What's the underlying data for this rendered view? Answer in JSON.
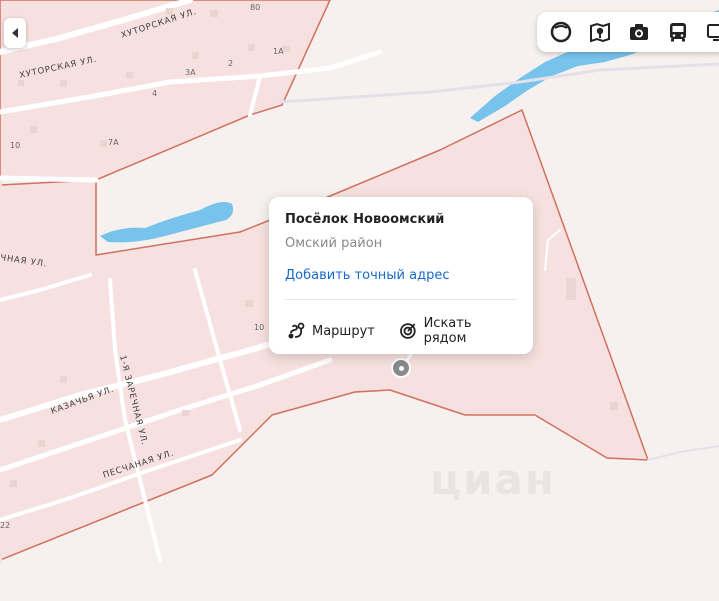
{
  "map": {
    "street_labels": {
      "khutorskaya_top": "ХУТОРСКАЯ УЛ.",
      "khutorskaya_left": "ХУТОРСКАЯ УЛ.",
      "zarechnaya_partial": "ЧНАЯ УЛ.",
      "kazachya": "КАЗАЧЬЯ УЛ.",
      "zarechnaya_1": "1-Я ЗАРЕЧНАЯ УЛ.",
      "peschanaya": "ПЕСЧАНАЯ УЛ."
    },
    "house_numbers": {
      "h80": "80",
      "h1a": "1А",
      "h2": "2",
      "h3a": "3А",
      "h4": "4",
      "h7a": "7А",
      "h10_top": "10",
      "h10_mid": "10",
      "h22": "22"
    },
    "colors": {
      "settlement_fill": "#f7e1e0",
      "boundary": "#d0705f",
      "water": "#78c3ec",
      "road": "#ffffff",
      "background": "#f6f1ef"
    }
  },
  "controls": {
    "collapse_icon": "triangle-left-icon",
    "layers": [
      {
        "name": "panorama-icon"
      },
      {
        "name": "traffic-layer-icon"
      },
      {
        "name": "photo-icon"
      },
      {
        "name": "transport-icon"
      },
      {
        "name": "screen-icon"
      }
    ]
  },
  "popup": {
    "title": "Посёлок Новоомский",
    "subtitle": "Омский район",
    "add_address_link": "Добавить точный адрес",
    "route_label": "Маршрут",
    "nearby_label": "Искать рядом"
  },
  "watermark": {
    "text": "циан"
  }
}
